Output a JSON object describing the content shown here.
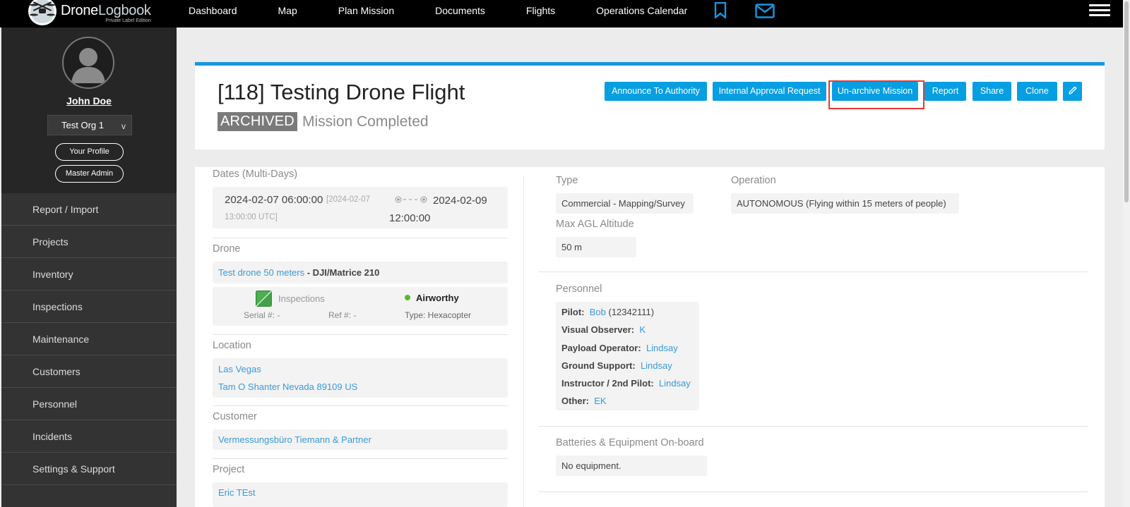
{
  "app": {
    "brand_part1": "Drone",
    "brand_part2": "Logbook",
    "edition": "Private Label Edition"
  },
  "nav": {
    "items": [
      "Dashboard",
      "Map",
      "Plan Mission",
      "Documents",
      "Flights",
      "Operations Calendar"
    ]
  },
  "sidebar": {
    "user_name": "John Doe",
    "org": "Test Org 1",
    "org_chevron": "v",
    "profile_button": "Your Profile",
    "admin_button": "Master Admin",
    "items": [
      "Report / Import",
      "Projects",
      "Inventory",
      "Inspections",
      "Maintenance",
      "Customers",
      "Personnel",
      "Incidents",
      "Settings & Support"
    ]
  },
  "mission": {
    "title": "[118] Testing Drone Flight",
    "archived_badge": "ARCHIVED",
    "status": "Mission Completed",
    "actions": [
      "Announce To Authority",
      "Internal Approval Request",
      "Un-archive Mission",
      "Report",
      "Share",
      "Clone"
    ]
  },
  "dates": {
    "label": "Dates (Multi-Days)",
    "start": "2024-02-07 06:00:00",
    "start_utc_a": "[2024-02-07",
    "start_utc_b": "13:00:00 UTC]",
    "end_a": "2024-02-09",
    "end_b": "12:00:00"
  },
  "drone": {
    "label": "Drone",
    "name": "Test drone 50 meters",
    "model": " - DJI/Matrice 210",
    "inspections_label": "Inspections",
    "status": "Airworthy",
    "serial": "Serial #: -",
    "ref": "Ref #: -",
    "type": "Type: Hexacopter"
  },
  "location": {
    "label": "Location",
    "line1": "Las Vegas",
    "line2": "Tam O Shanter Nevada 89109 US"
  },
  "customer": {
    "label": "Customer",
    "name": "Vermessungsbüro Tiemann & Partner"
  },
  "project": {
    "label": "Project",
    "name": "Eric TEst"
  },
  "type": {
    "label": "Type",
    "value": "Commercial - Mapping/Survey"
  },
  "operation": {
    "label": "Operation",
    "value": "AUTONOMOUS (Flying within 15 meters of people)"
  },
  "altitude": {
    "label": "Max AGL Altitude",
    "value": "50 m"
  },
  "personnel": {
    "label": "Personnel",
    "roles": [
      {
        "role": "Pilot:",
        "name": "Bob",
        "extra": " (12342111)"
      },
      {
        "role": "Visual Observer:",
        "name": "K",
        "extra": ""
      },
      {
        "role": "Payload Operator:",
        "name": "Lindsay",
        "extra": ""
      },
      {
        "role": "Ground Support:",
        "name": "Lindsay",
        "extra": ""
      },
      {
        "role": "Instructor / 2nd Pilot:",
        "name": "Lindsay",
        "extra": ""
      },
      {
        "role": "Other:",
        "name": "EK",
        "extra": ""
      }
    ]
  },
  "equipment": {
    "label": "Batteries & Equipment On-board",
    "value": "No equipment."
  },
  "colors": {
    "accent": "#089ee2",
    "highlight": "#e53935",
    "sidebar": "#333333",
    "airworthy": "#5cb82a"
  },
  "icons": [
    "drone-logo-icon",
    "bookmark-icon",
    "envelope-icon",
    "hamburger-menu-icon",
    "user-avatar-icon",
    "pencil-icon",
    "inspection-status-icon",
    "timeline-icon"
  ]
}
